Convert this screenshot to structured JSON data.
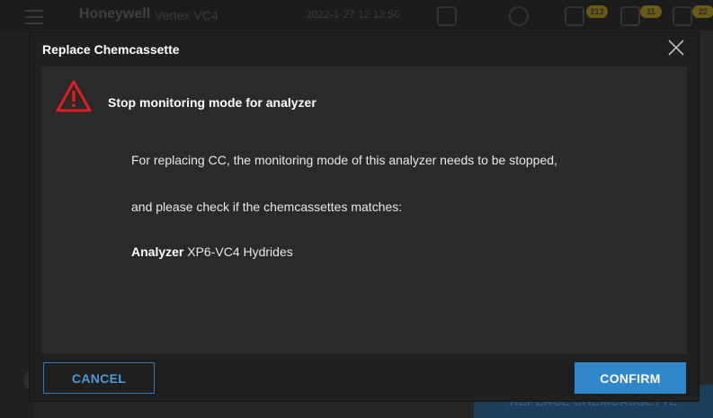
{
  "background": {
    "brand": "Honeywell",
    "device_name": "Vertex VC4",
    "datetime": "2022-1-27  12:13:56",
    "badges": [
      "213",
      "11",
      "22"
    ],
    "bottom_button_label": "REPLACE CHEMCASSETTE"
  },
  "dialog": {
    "title": "Replace Chemcassette",
    "close_icon": "close-icon",
    "warning_icon": "warning-triangle-icon",
    "warning_title": "Stop monitoring mode for analyzer",
    "message_line1": "For replacing CC, the monitoring mode of this analyzer needs to be stopped,",
    "message_line2": "and please check if the chemcassettes matches:",
    "analyzer_label": "Analyzer",
    "analyzer_value": "XP6-VC4 Hydrides",
    "cancel_label": "CANCEL",
    "confirm_label": "CONFIRM"
  },
  "colors": {
    "accent": "#2f86c9",
    "warning": "#e31b23",
    "dialog_bg": "#1f1f1f",
    "body_bg": "#2a2a2a"
  }
}
